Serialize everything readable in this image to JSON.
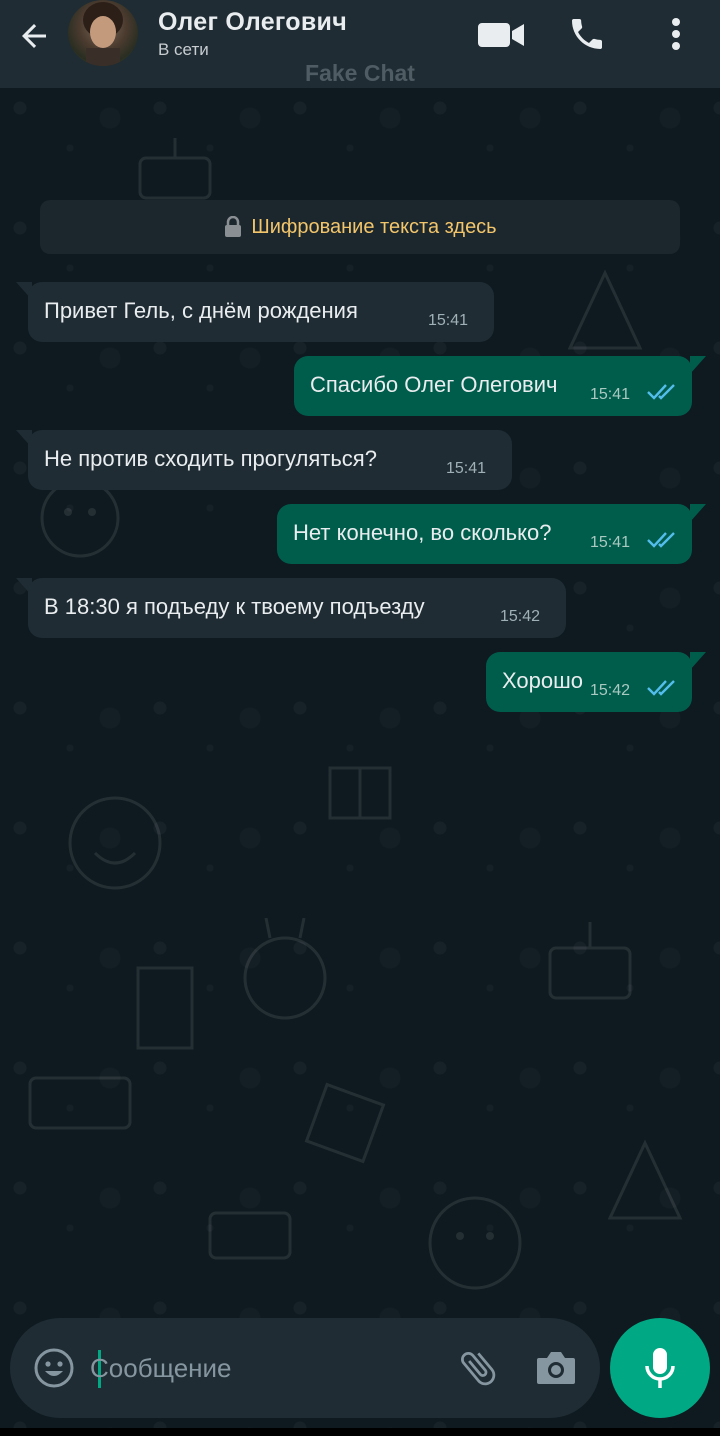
{
  "header": {
    "contact_name": "Олег Олегович",
    "status": "В сети",
    "icons": [
      "back-arrow-icon",
      "video-call-icon",
      "phone-icon",
      "more-vert-icon"
    ]
  },
  "watermark": "Fake Chat",
  "encryption_notice": "Шифрование текста здесь",
  "messages": [
    {
      "direction": "incoming",
      "text": "Привет Гель, с днём рождения",
      "time": "15:41"
    },
    {
      "direction": "outgoing",
      "text": "Спасибо Олег Олегович",
      "time": "15:41",
      "status": "read"
    },
    {
      "direction": "incoming",
      "text": "Не против сходить прогуляться?",
      "time": "15:41"
    },
    {
      "direction": "outgoing",
      "text": "Нет конечно, во сколько?",
      "time": "15:41",
      "status": "read"
    },
    {
      "direction": "incoming",
      "text": "В 18:30 я подъеду к твоему подъезду",
      "time": "15:42"
    },
    {
      "direction": "outgoing",
      "text": "Хорошо",
      "time": "15:42",
      "status": "read"
    }
  ],
  "composer": {
    "placeholder": "Сообщение",
    "icons": [
      "emoji-icon",
      "attach-icon",
      "camera-icon",
      "mic-icon"
    ]
  },
  "colors": {
    "header_bg": "#1f2c33",
    "incoming_bubble": "#1f2c33",
    "outgoing_bubble": "#005c4b",
    "accent": "#00a884",
    "read_ticks": "#53bdeb",
    "encryption_text": "#f2c56b"
  }
}
